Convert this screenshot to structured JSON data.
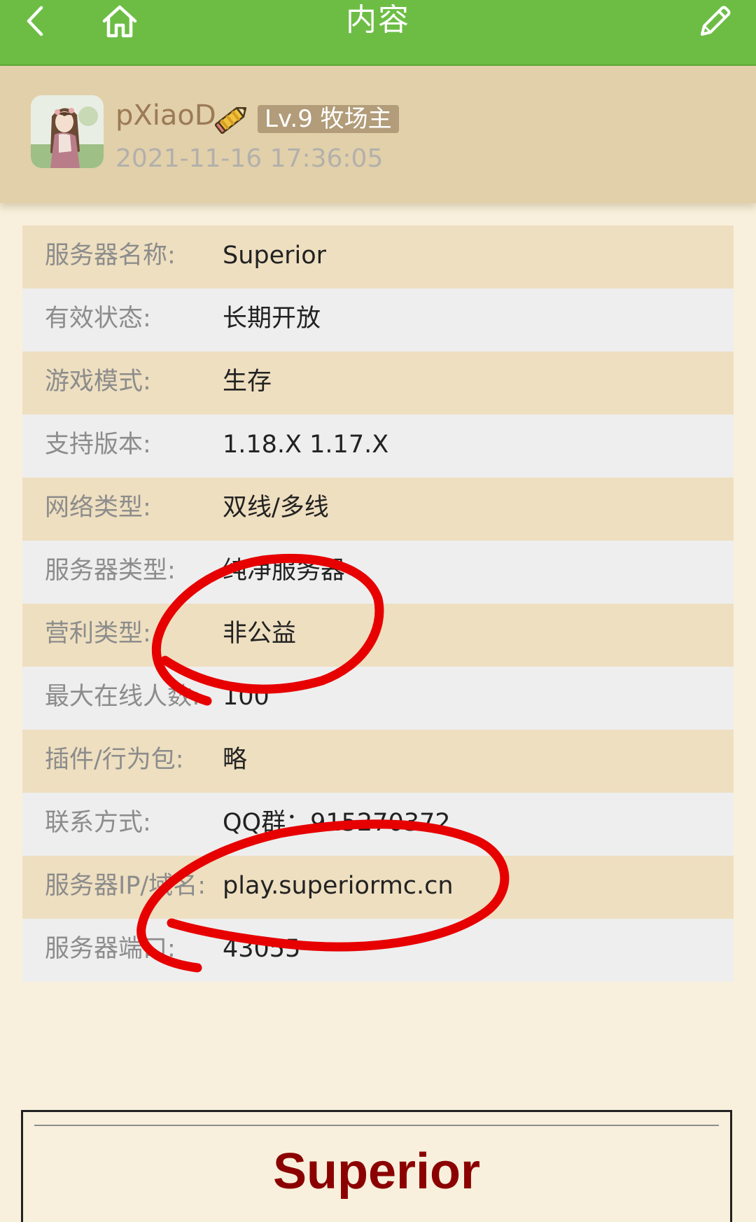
{
  "header": {
    "title": "内容",
    "back_icon": "chevron-left-icon",
    "home_icon": "home-icon",
    "edit_icon": "pencil-icon",
    "background_color": "#6dbd45"
  },
  "post": {
    "author": "pXiaoD",
    "level_badge": "Lv.9 牧场主",
    "timestamp": "2021-11-16 17:36:05"
  },
  "server_info": [
    {
      "label": "服务器名称:",
      "value": "Superior"
    },
    {
      "label": "有效状态:",
      "value": "长期开放"
    },
    {
      "label": "游戏模式:",
      "value": "生存"
    },
    {
      "label": "支持版本:",
      "value": "1.18.X 1.17.X"
    },
    {
      "label": "网络类型:",
      "value": "双线/多线"
    },
    {
      "label": "服务器类型:",
      "value": "纯净服务器"
    },
    {
      "label": "营利类型:",
      "value": "非公益"
    },
    {
      "label": "最大在线人数:",
      "value": "100"
    },
    {
      "label": "插件/行为包:",
      "value": "略"
    },
    {
      "label": "联系方式:",
      "value": "QQ群：915270372"
    },
    {
      "label": "服务器IP/域名:",
      "value": "play.superiormc.cn"
    },
    {
      "label": "服务器端口:",
      "value": "43055"
    }
  ],
  "content": {
    "title": "Superior"
  },
  "colors": {
    "header_band": "#e1d0aa",
    "row_odd": "#eedfc0",
    "row_even": "#eeeeee",
    "annotation": "#e60000",
    "content_title": "#8b0000"
  }
}
